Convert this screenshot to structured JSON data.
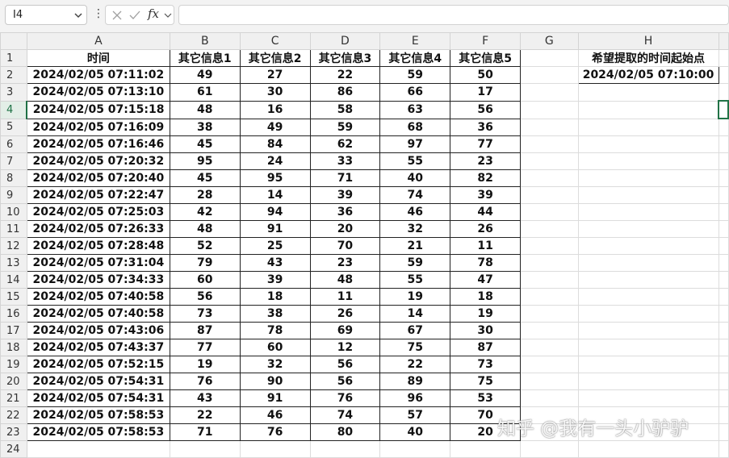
{
  "formula_bar": {
    "name_box": "I4",
    "fx_label": "fx",
    "formula": ""
  },
  "columns": [
    "A",
    "B",
    "C",
    "D",
    "E",
    "F",
    "G",
    "H"
  ],
  "header_row": {
    "A": "时间",
    "B": "其它信息1",
    "C": "其它信息2",
    "D": "其它信息3",
    "E": "其它信息4",
    "F": "其它信息5",
    "G": "",
    "H": "希望提取的时间起始点"
  },
  "h2_value": "2024/02/05 07:10:00",
  "rows": [
    {
      "n": "2",
      "A": "2024/02/05 07:11:02",
      "B": "49",
      "C": "27",
      "D": "22",
      "E": "59",
      "F": "50"
    },
    {
      "n": "3",
      "A": "2024/02/05 07:13:10",
      "B": "61",
      "C": "30",
      "D": "86",
      "E": "66",
      "F": "17"
    },
    {
      "n": "4",
      "A": "2024/02/05 07:15:18",
      "B": "48",
      "C": "16",
      "D": "58",
      "E": "63",
      "F": "56"
    },
    {
      "n": "5",
      "A": "2024/02/05 07:16:09",
      "B": "38",
      "C": "49",
      "D": "59",
      "E": "68",
      "F": "36"
    },
    {
      "n": "6",
      "A": "2024/02/05 07:16:46",
      "B": "45",
      "C": "84",
      "D": "62",
      "E": "97",
      "F": "77"
    },
    {
      "n": "7",
      "A": "2024/02/05 07:20:32",
      "B": "95",
      "C": "24",
      "D": "33",
      "E": "55",
      "F": "23"
    },
    {
      "n": "8",
      "A": "2024/02/05 07:20:40",
      "B": "45",
      "C": "95",
      "D": "71",
      "E": "40",
      "F": "82"
    },
    {
      "n": "9",
      "A": "2024/02/05 07:22:47",
      "B": "28",
      "C": "14",
      "D": "39",
      "E": "74",
      "F": "39"
    },
    {
      "n": "10",
      "A": "2024/02/05 07:25:03",
      "B": "42",
      "C": "94",
      "D": "36",
      "E": "46",
      "F": "44"
    },
    {
      "n": "11",
      "A": "2024/02/05 07:26:33",
      "B": "48",
      "C": "91",
      "D": "20",
      "E": "32",
      "F": "26"
    },
    {
      "n": "12",
      "A": "2024/02/05 07:28:48",
      "B": "52",
      "C": "25",
      "D": "70",
      "E": "21",
      "F": "11"
    },
    {
      "n": "13",
      "A": "2024/02/05 07:31:04",
      "B": "79",
      "C": "43",
      "D": "23",
      "E": "59",
      "F": "78"
    },
    {
      "n": "14",
      "A": "2024/02/05 07:34:33",
      "B": "60",
      "C": "39",
      "D": "48",
      "E": "55",
      "F": "47"
    },
    {
      "n": "15",
      "A": "2024/02/05 07:40:58",
      "B": "56",
      "C": "18",
      "D": "11",
      "E": "19",
      "F": "18"
    },
    {
      "n": "16",
      "A": "2024/02/05 07:40:58",
      "B": "73",
      "C": "38",
      "D": "26",
      "E": "14",
      "F": "19"
    },
    {
      "n": "17",
      "A": "2024/02/05 07:43:06",
      "B": "87",
      "C": "78",
      "D": "69",
      "E": "67",
      "F": "30"
    },
    {
      "n": "18",
      "A": "2024/02/05 07:43:37",
      "B": "77",
      "C": "60",
      "D": "12",
      "E": "75",
      "F": "87"
    },
    {
      "n": "19",
      "A": "2024/02/05 07:52:15",
      "B": "19",
      "C": "32",
      "D": "56",
      "E": "22",
      "F": "73"
    },
    {
      "n": "20",
      "A": "2024/02/05 07:54:31",
      "B": "76",
      "C": "90",
      "D": "56",
      "E": "89",
      "F": "75"
    },
    {
      "n": "21",
      "A": "2024/02/05 07:54:31",
      "B": "43",
      "C": "91",
      "D": "76",
      "E": "96",
      "F": "53"
    },
    {
      "n": "22",
      "A": "2024/02/05 07:58:53",
      "B": "22",
      "C": "46",
      "D": "74",
      "E": "57",
      "F": "70"
    },
    {
      "n": "23",
      "A": "2024/02/05 07:58:53",
      "B": "71",
      "C": "76",
      "D": "80",
      "E": "40",
      "F": "20"
    }
  ],
  "last_row_number": "24",
  "active_row": "4",
  "watermark": "知乎 @我有一头小驴驴",
  "colors": {
    "selection": "#217346",
    "header_bg": "#f0f0f0"
  },
  "icons": [
    "chevron-down-icon",
    "more-options-icon",
    "cancel-icon",
    "confirm-icon",
    "function-icon"
  ]
}
